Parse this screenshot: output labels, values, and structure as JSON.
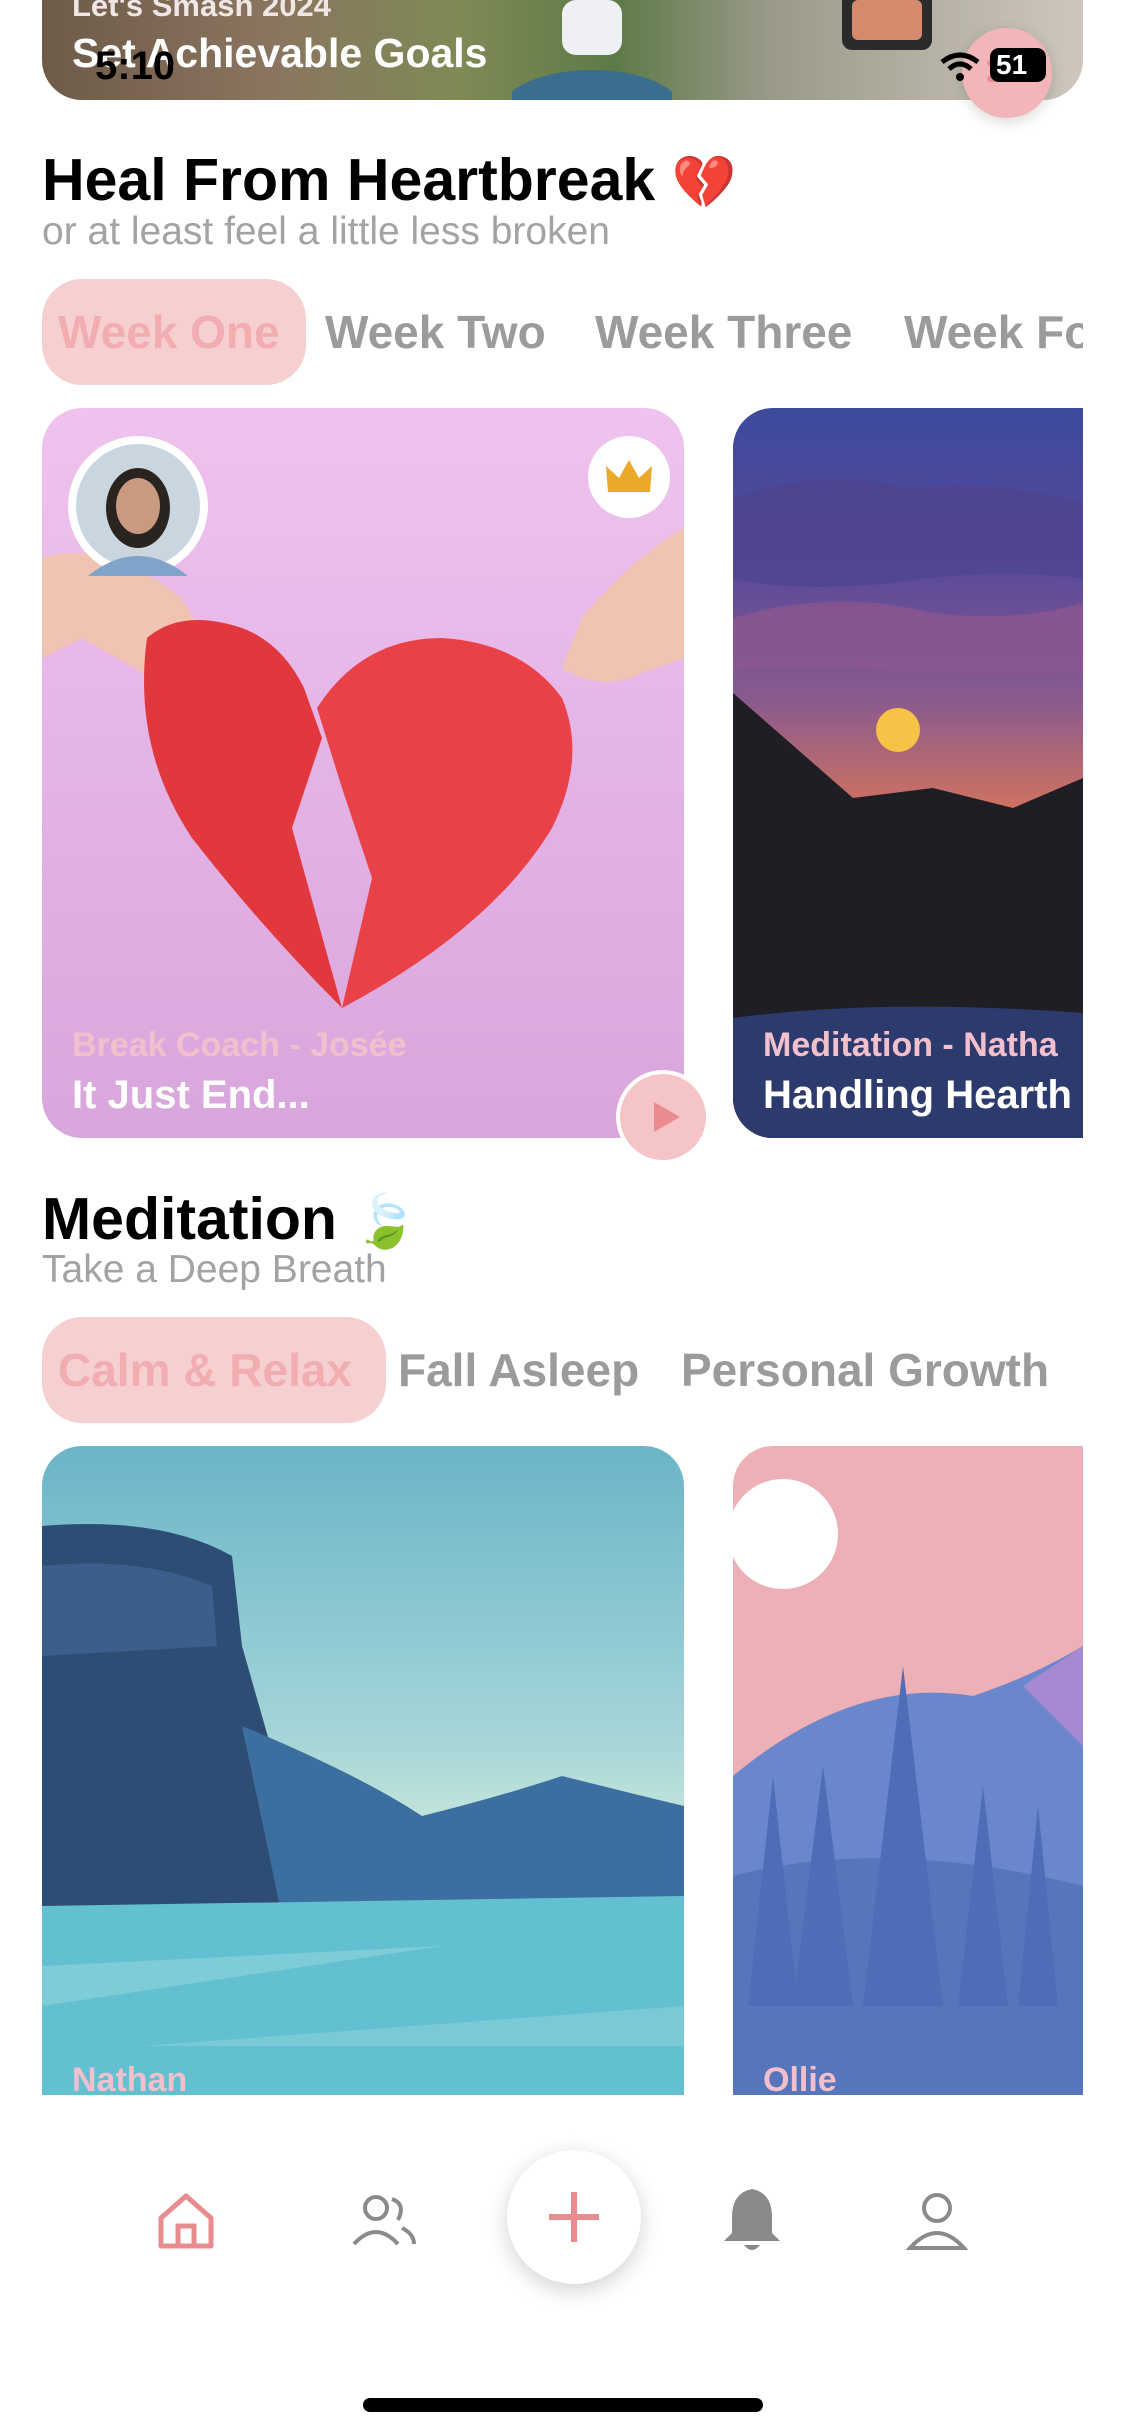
{
  "status_bar": {
    "time": "5:10",
    "battery": "51"
  },
  "top_banner": {
    "subtitle": "Let's Smash 2024",
    "title": "Set Achievable Goals"
  },
  "heartbreak": {
    "title": "Heal From Heartbreak",
    "emoji": "💔",
    "subtitle": "or at least feel a little less broken",
    "tabs": [
      "Week One",
      "Week Two",
      "Week Three",
      "Week Fo"
    ],
    "cards": [
      {
        "category": "Break Coach - Josée",
        "title": "It Just End..."
      },
      {
        "category": "Meditation - Natha",
        "title": "Handling Hearth"
      }
    ]
  },
  "meditation": {
    "title": "Meditation",
    "emoji": "🍃",
    "subtitle": "Take a Deep Breath",
    "tabs": [
      "Calm & Relax",
      "Fall Asleep",
      "Personal Growth"
    ],
    "cards": [
      {
        "category": "Nathan"
      },
      {
        "category": "Ollie"
      }
    ]
  },
  "nav": {
    "items": [
      "home-icon",
      "community-icon",
      "add-icon",
      "bell-icon",
      "profile-icon"
    ]
  },
  "colors": {
    "accent": "#f1adb0",
    "accent_bg": "#f6d0d1",
    "nav_icon": "#8a8a8a"
  }
}
